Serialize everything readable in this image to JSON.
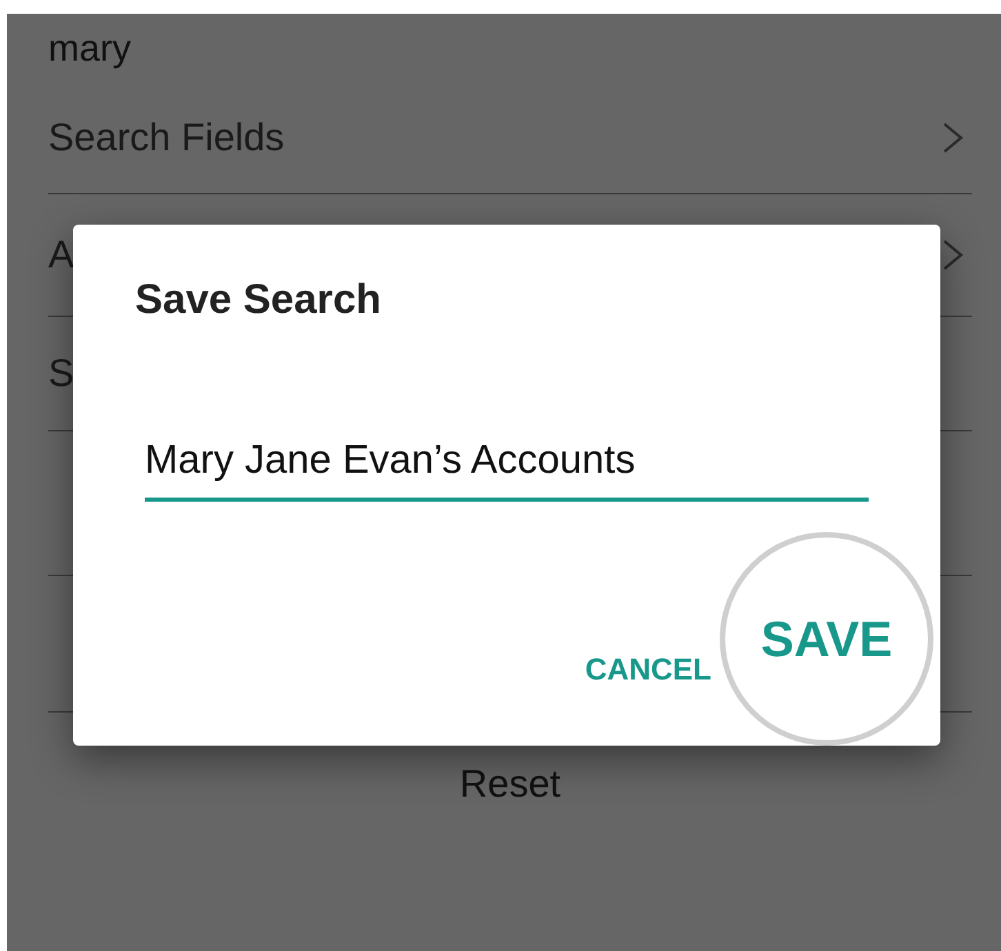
{
  "background": {
    "query": "mary",
    "rows": [
      {
        "label": "Search Fields",
        "chevron": true
      },
      {
        "label": "A",
        "chevron": true
      },
      {
        "label": "S",
        "chevron": false
      }
    ],
    "reset": "Reset"
  },
  "dialog": {
    "title": "Save Search",
    "input": {
      "value": "Mary Jane Evan’s Accounts"
    },
    "buttons": [
      {
        "label": "CANCEL",
        "kind": "text"
      },
      {
        "label": "SAVE",
        "kind": "highlighted"
      }
    ]
  }
}
